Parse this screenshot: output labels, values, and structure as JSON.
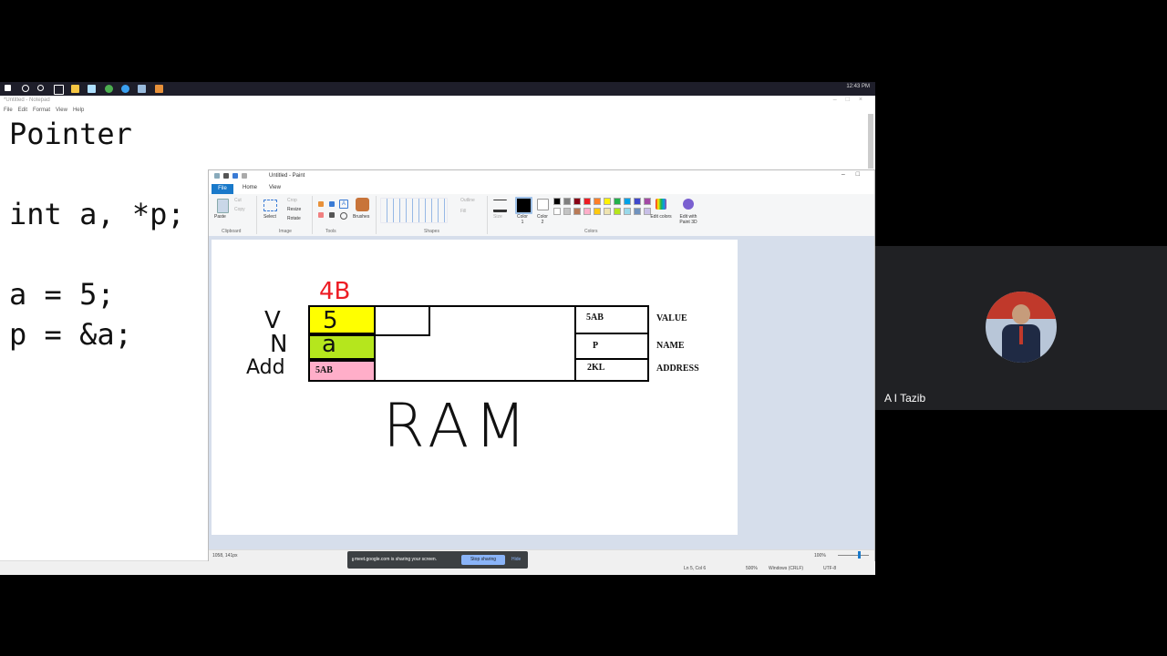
{
  "taskbar": {
    "tray_time": "12:43 PM",
    "icons": [
      "windows-icon",
      "search-icon",
      "cortana-icon",
      "task-view-icon",
      "file-explorer-icon",
      "notepad-icon",
      "chrome-icon",
      "edge-icon",
      "paint-icon",
      "store-icon"
    ]
  },
  "notepad": {
    "title": "*Untitled - Notepad",
    "menu": [
      "File",
      "Edit",
      "Format",
      "View",
      "Help"
    ],
    "content": "Pointer\n\nint a, *p;\n\na = 5;\np = &a;",
    "status": {
      "position": "Ln 5, Col 6",
      "zoom": "500%",
      "line_ending": "Windows (CRLF)",
      "encoding": "UTF-8"
    }
  },
  "paint": {
    "title": "Untitled - Paint",
    "tabs": {
      "file": "File",
      "home": "Home",
      "view": "View"
    },
    "ribbon": {
      "clipboard": {
        "label": "Clipboard",
        "paste": "Paste",
        "cut": "Cut",
        "copy": "Copy"
      },
      "image": {
        "label": "Image",
        "select": "Select",
        "crop": "Crop",
        "resize": "Resize",
        "rotate": "Rotate"
      },
      "tools": {
        "label": "Tools",
        "brushes": "Brushes"
      },
      "shapes": {
        "label": "Shapes",
        "outline": "Outline",
        "fill": "Fill"
      },
      "size": "Size",
      "color1": "Color 1",
      "color2": "Color 2",
      "colors": {
        "label": "Colors",
        "edit": "Edit colors",
        "paint3d": "Edit with Paint 3D"
      }
    },
    "palette": [
      "#000000",
      "#7f7f7f",
      "#880015",
      "#ed1c24",
      "#ff7f27",
      "#fff200",
      "#22b14c",
      "#00a2e8",
      "#3f48cc",
      "#a349a4",
      "#ffffff",
      "#c3c3c3",
      "#b97a57",
      "#ffaec9",
      "#ffc90e",
      "#efe4b0",
      "#b5e61d",
      "#99d9ea",
      "#7092be",
      "#c8bfe7"
    ],
    "status": {
      "cursor": "1058, 141px",
      "zoom": "100%"
    },
    "canvas": {
      "size_note": "4B",
      "left_labels": [
        "V",
        "N",
        "Add"
      ],
      "cell_value": "5",
      "cell_name": "a",
      "cell_addr": "5AB",
      "right_value": "5AB",
      "right_name": "P",
      "right_addr": "2KL",
      "row_labels": [
        "VALUE",
        "NAME",
        "ADDRESS"
      ],
      "ram_label": "RAM",
      "colors": {
        "value": "#ffff00",
        "name": "#b5e61d",
        "addr": "#ffaec9",
        "note": "#ed1c24"
      }
    }
  },
  "meet": {
    "share_text": "meet.google.com is sharing your screen.",
    "stop": "Stop sharing",
    "hide": "Hide",
    "participant_name": "A I Tazib"
  }
}
